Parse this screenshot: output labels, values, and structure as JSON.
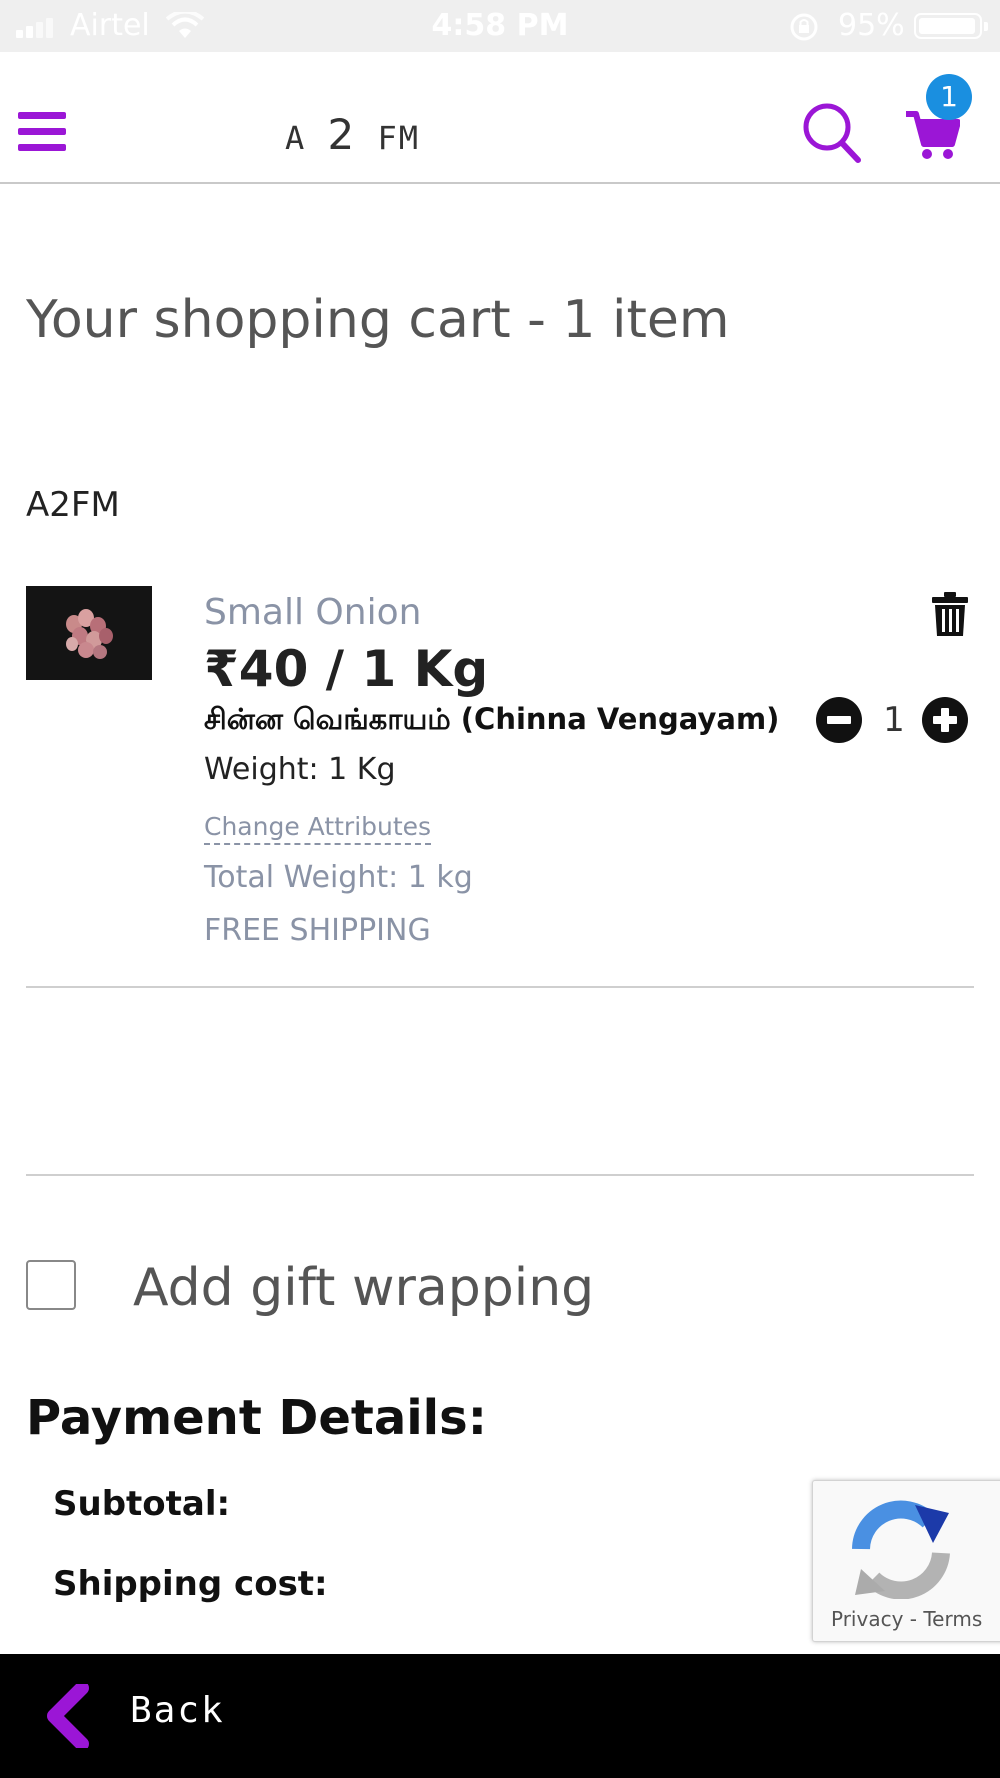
{
  "status_bar": {
    "carrier": "Airtel",
    "time": "4:58 PM",
    "battery": "95%"
  },
  "header": {
    "logo_left": "A",
    "logo_mid": "2",
    "logo_right": "FM",
    "cart_count": "1",
    "accent_color": "#9b16d6",
    "badge_color": "#1a8fe0"
  },
  "cart": {
    "title": "Your shopping cart - 1 item",
    "vendor": "A2FM",
    "item": {
      "name": "Small Onion",
      "price": "₹40 / 1 Kg",
      "local_name": "சின்ன வெங்காயம் (Chinna Vengayam)",
      "weight": "Weight: 1 Kg",
      "change_link": "Change Attributes",
      "total_weight": "Total Weight: 1 kg",
      "shipping_note": "FREE SHIPPING",
      "quantity": "1"
    }
  },
  "gift": {
    "label": "Add gift wrapping",
    "checked": false
  },
  "payment": {
    "title": "Payment Details:",
    "subtotal_label": "Subtotal:",
    "shipping_label": "Shipping cost:"
  },
  "recaptcha": {
    "privacy": "Privacy",
    "separator": " - ",
    "terms": "Terms"
  },
  "footer": {
    "back_label": "Back"
  }
}
